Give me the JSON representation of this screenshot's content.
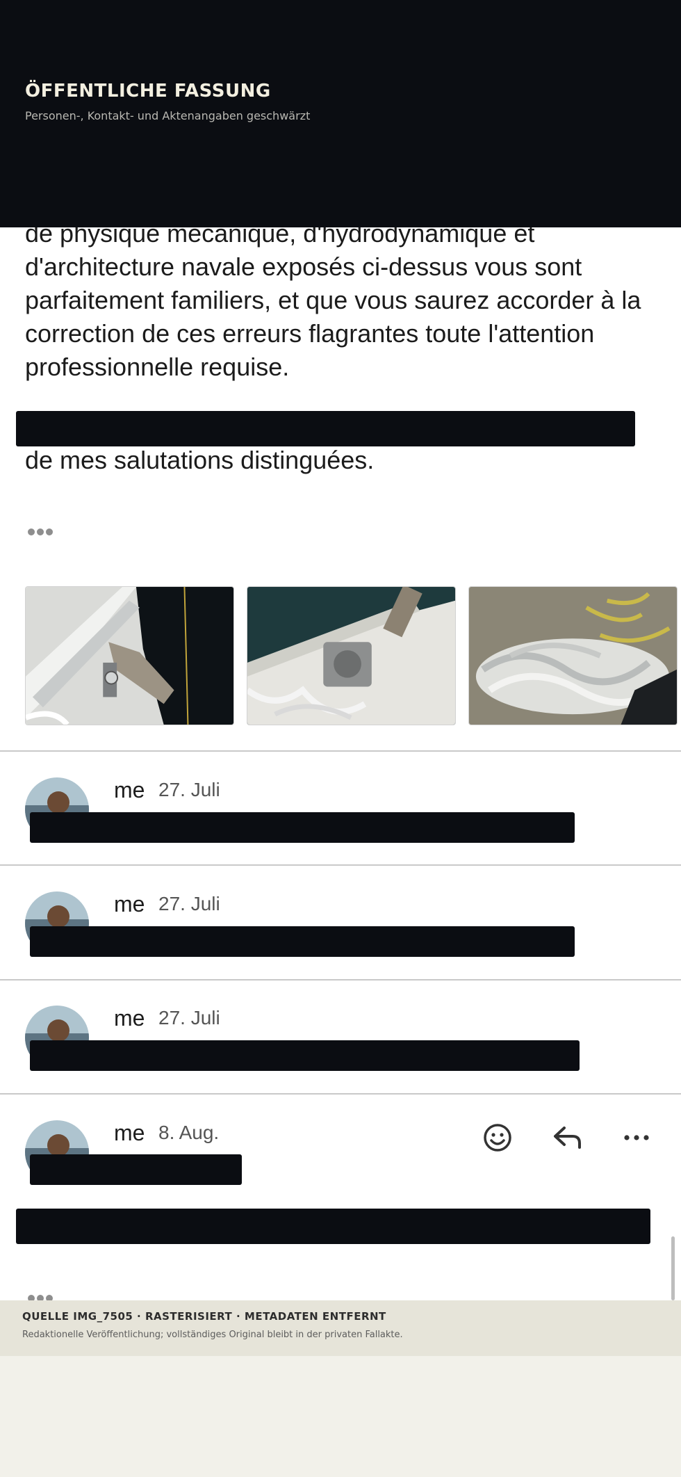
{
  "publication_header": {
    "title": "ÖFFENTLICHE FASSUNG",
    "subtitle": "Personen-, Kontakt- und Aktenangaben geschwärzt"
  },
  "email_body": {
    "paragraph": "de physique mécanique, d'hydrodynamique et d'architecture navale exposés ci-dessus vous sont parfaitement familiers, et que vous saurez accorder à la correction de ces erreurs flagrantes toute l'attention professionnelle requise.",
    "signoff": "de mes salutations distinguées."
  },
  "attachments": [
    {
      "icon": "boat-deck-photo"
    },
    {
      "icon": "windlass-photo"
    },
    {
      "icon": "rope-pile-photo"
    }
  ],
  "messages": [
    {
      "sender": "me",
      "date": "27. Juli"
    },
    {
      "sender": "me",
      "date": "27. Juli"
    },
    {
      "sender": "me",
      "date": "27. Juli"
    },
    {
      "sender": "me",
      "date": "8. Aug."
    }
  ],
  "actions": {
    "emoji_icon": "smiley-icon",
    "reply_icon": "reply-arrow-icon",
    "more_icon": "ellipsis-icon"
  },
  "colors": {
    "redaction": "#0b0d12",
    "header_bg": "#0b0d12",
    "footer_bg": "#e6e4d9"
  },
  "publication_footer": {
    "source_line": "QUELLE IMG_7505 · RASTERISIERT · METADATEN ENTFERNT",
    "note": "Redaktionelle Veröffentlichung; vollständiges Original bleibt in der privaten Fallakte."
  }
}
